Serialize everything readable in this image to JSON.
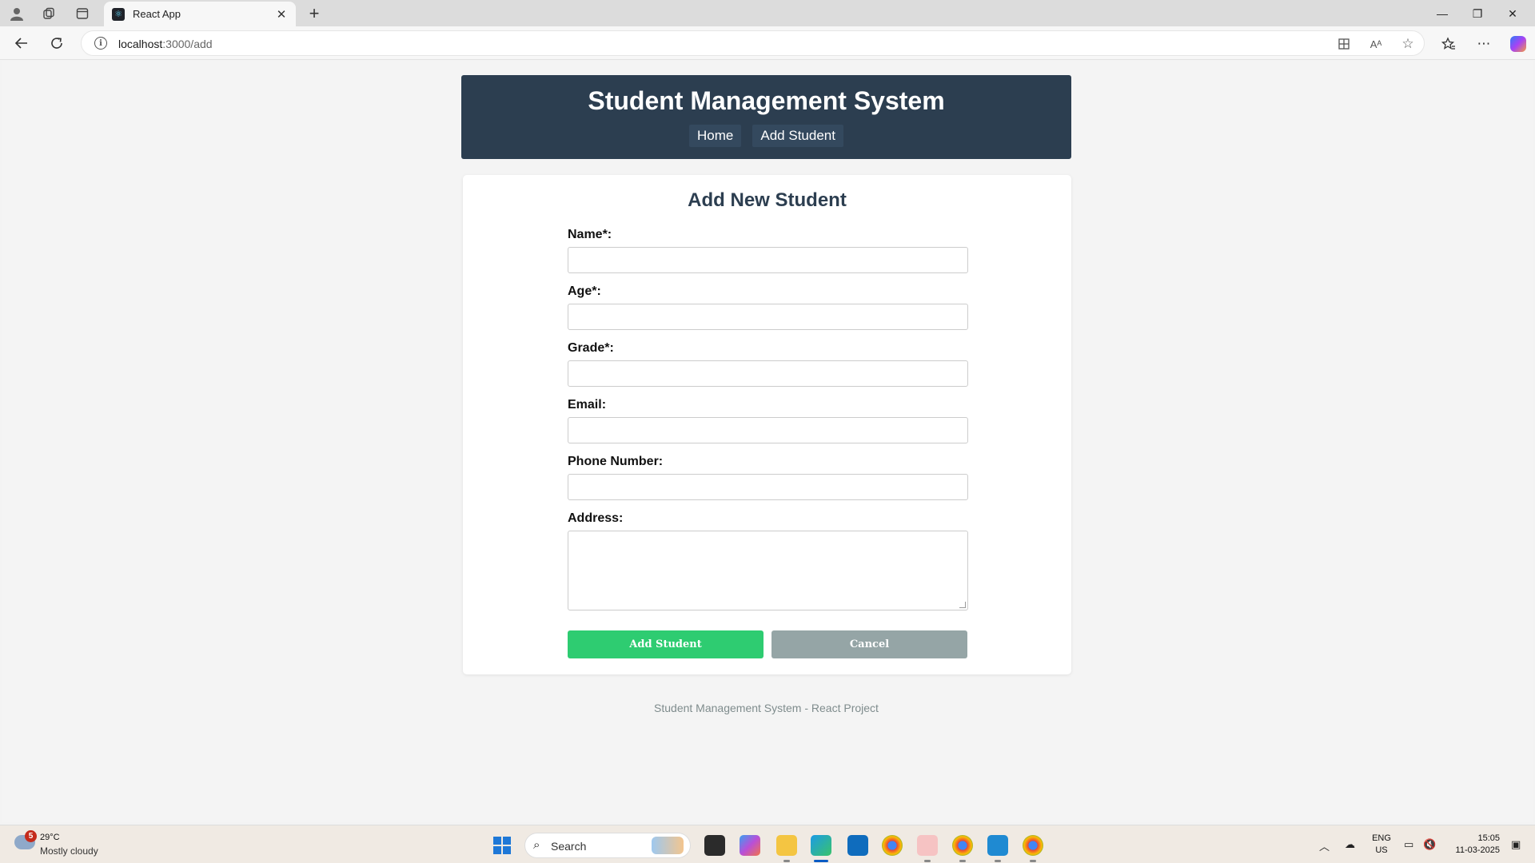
{
  "browser": {
    "tab_title": "React App",
    "tab_close": "✕",
    "new_tab": "+",
    "url_host": "localhost",
    "url_path": ":3000/add",
    "window_controls": {
      "minimize": "—",
      "maximize": "❐",
      "close": "✕"
    }
  },
  "app": {
    "title": "Student Management System",
    "nav": [
      {
        "label": "Home"
      },
      {
        "label": "Add Student"
      }
    ]
  },
  "form": {
    "title": "Add New Student",
    "fields": [
      {
        "label": "Name*:",
        "value": ""
      },
      {
        "label": "Age*:",
        "value": ""
      },
      {
        "label": "Grade*:",
        "value": ""
      },
      {
        "label": "Email:",
        "value": ""
      },
      {
        "label": "Phone Number:",
        "value": ""
      },
      {
        "label": "Address:",
        "value": ""
      }
    ],
    "submit_label": "Add Student",
    "cancel_label": "Cancel"
  },
  "footer": {
    "text": "Student Management System - React Project"
  },
  "taskbar": {
    "weather_badge": "5",
    "weather_temp": "29°C",
    "weather_desc": "Mostly cloudy",
    "search_placeholder": "Search",
    "lang_top": "ENG",
    "lang_bottom": "US",
    "time": "15:05",
    "date": "11-03-2025"
  },
  "colors": {
    "header_bg": "#2c3e50",
    "nav_link_bg": "#34495e",
    "submit_bg": "#2ecc71",
    "cancel_bg": "#95a5a6",
    "footer_text": "#7f8c8d"
  }
}
